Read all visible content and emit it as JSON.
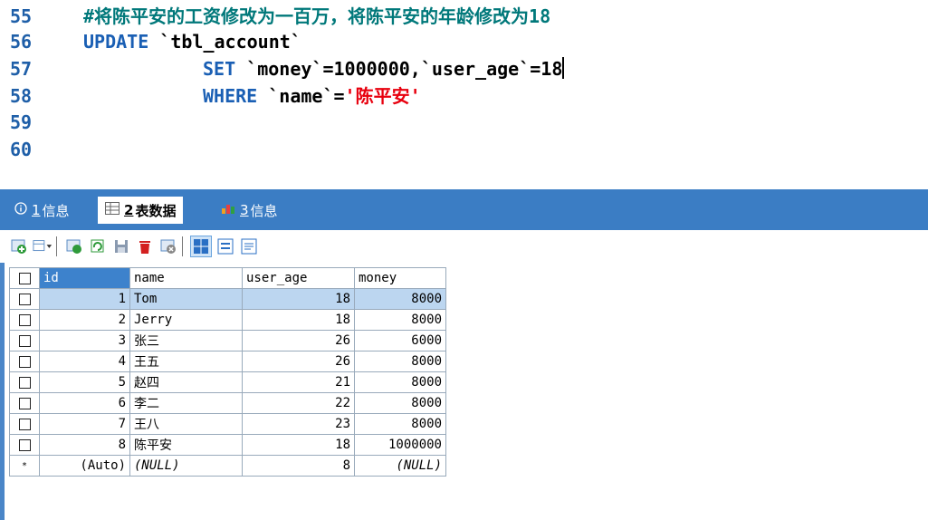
{
  "editor": {
    "line_numbers": [
      "55",
      "56",
      "57",
      "58",
      "59",
      "60"
    ],
    "lines": {
      "l55": "#将陈平安的工资修改为一百万，将陈平安的年龄修改为18",
      "l56_kw": "UPDATE",
      "l56_rest": " `tbl_account`",
      "l57_kw": "SET",
      "l57_rest": " `money`=1000000,`user_age`=18",
      "l58_kw": "WHERE",
      "l58_rest": " `name`=",
      "l58_str": "'陈平安'"
    }
  },
  "tabs": [
    {
      "num": "1",
      "label": " 信息",
      "icon": "info-icon"
    },
    {
      "num": "2",
      "label": " 表数据",
      "icon": "table-icon"
    },
    {
      "num": "3",
      "label": " 信息",
      "icon": "chart-icon"
    }
  ],
  "grid": {
    "columns": [
      "id",
      "name",
      "user_age",
      "money"
    ],
    "rows": [
      {
        "id": "1",
        "name": "Tom",
        "user_age": "18",
        "money": "8000"
      },
      {
        "id": "2",
        "name": "Jerry",
        "user_age": "18",
        "money": "8000"
      },
      {
        "id": "3",
        "name": "张三",
        "user_age": "26",
        "money": "6000"
      },
      {
        "id": "4",
        "name": "王五",
        "user_age": "26",
        "money": "8000"
      },
      {
        "id": "5",
        "name": "赵四",
        "user_age": "21",
        "money": "8000"
      },
      {
        "id": "6",
        "name": "李二",
        "user_age": "22",
        "money": "8000"
      },
      {
        "id": "7",
        "name": "王八",
        "user_age": "23",
        "money": "8000"
      },
      {
        "id": "8",
        "name": "陈平安",
        "user_age": "18",
        "money": "1000000"
      }
    ],
    "new_row": {
      "marker": "*",
      "id": "(Auto)",
      "name": "(NULL)",
      "user_age": "8",
      "money": "(NULL)"
    }
  },
  "colors": {
    "line_number": "#1f5fa8",
    "comment": "#00787a",
    "keyword": "#1a5fb4",
    "string": "#e8000e",
    "tabbar": "#3b7dc4",
    "selected_row": "#bcd6f0"
  }
}
